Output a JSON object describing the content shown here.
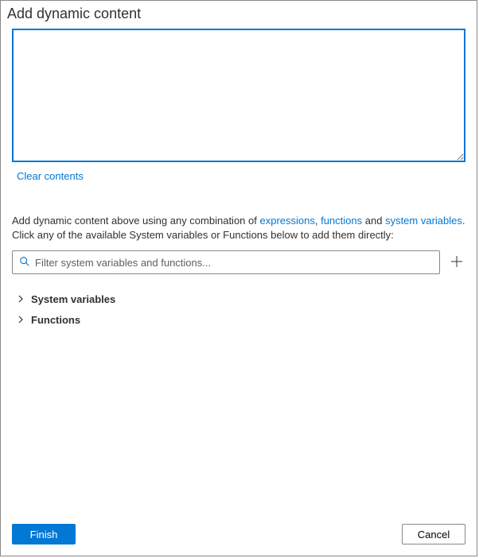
{
  "dialog": {
    "title": "Add dynamic content",
    "clear_link": "Clear contents",
    "help_prefix": "Add dynamic content above using any combination of ",
    "help_link_expressions": "expressions",
    "help_comma": ", ",
    "help_link_functions": "functions",
    "help_and": " and ",
    "help_link_system_vars": "system variables",
    "help_suffix": ". Click any of the available System variables or Functions below to add them directly:",
    "filter": {
      "placeholder": "Filter system variables and functions..."
    },
    "tree": {
      "system_variables": "System variables",
      "functions": "Functions"
    },
    "buttons": {
      "finish": "Finish",
      "cancel": "Cancel"
    }
  }
}
